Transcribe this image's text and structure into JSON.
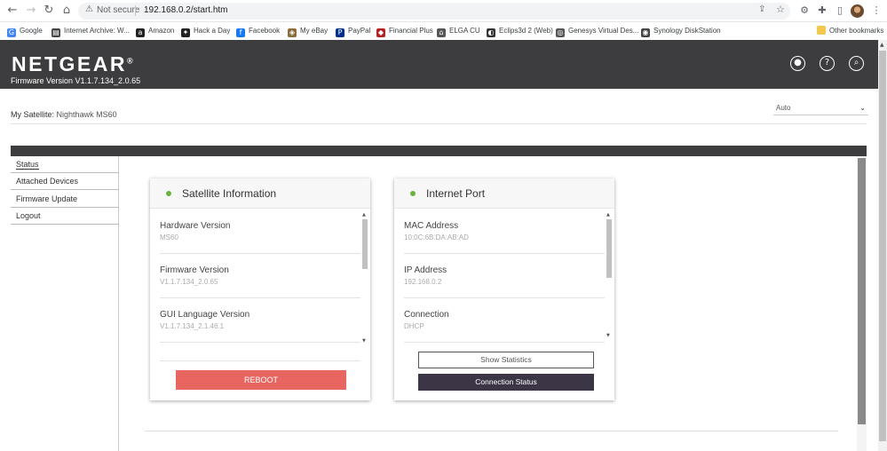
{
  "browser": {
    "not_secure": "Not secure",
    "url": "192.168.0.2/start.htm",
    "bookmarks": [
      {
        "label": "Google",
        "icon": "google-icon",
        "color": "#4285f4"
      },
      {
        "label": "Internet Archive: W...",
        "icon": "archive-icon",
        "color": "#444444"
      },
      {
        "label": "Amazon",
        "icon": "amazon-icon",
        "color": "#222222"
      },
      {
        "label": "Hack a Day",
        "icon": "hackaday-icon",
        "color": "#222222"
      },
      {
        "label": "Facebook",
        "icon": "facebook-icon",
        "color": "#1877f2"
      },
      {
        "label": "My eBay",
        "icon": "ebay-icon",
        "color": "#8a6d3b"
      },
      {
        "label": "PayPal",
        "icon": "paypal-icon",
        "color": "#003087"
      },
      {
        "label": "Financial Plus",
        "icon": "financial-plus-icon",
        "color": "#b22222"
      },
      {
        "label": "ELGA CU",
        "icon": "elga-icon",
        "color": "#555555"
      },
      {
        "label": "Eclips3d 2 (Web)",
        "icon": "eclips3d-icon",
        "color": "#333333"
      },
      {
        "label": "Genesys Virtual Des...",
        "icon": "genesys-icon",
        "color": "#555555"
      },
      {
        "label": "Synology DiskStation",
        "icon": "synology-icon",
        "color": "#444444"
      }
    ],
    "other_bookmarks": "Other bookmarks"
  },
  "header": {
    "logo": "NETGEAR",
    "logo_mark": "®",
    "firmware_label": "Firmware Version V1.1.7.134_2.0.65"
  },
  "satellite": {
    "label": "My Satellite:",
    "value": "Nighthawk MS60",
    "selector_value": "Auto"
  },
  "nav": [
    {
      "label": "Status"
    },
    {
      "label": "Attached Devices"
    },
    {
      "label": "Firmware Update"
    },
    {
      "label": "Logout"
    }
  ],
  "satellite_card": {
    "title": "Satellite Information",
    "fields": [
      {
        "label": "Hardware Version",
        "value": "MS60"
      },
      {
        "label": "Firmware Version",
        "value": "V1.1.7.134_2.0.65"
      },
      {
        "label": "GUI Language Version",
        "value": "V1.1.7.134_2.1.46.1"
      }
    ],
    "reboot": "REBOOT"
  },
  "internet_card": {
    "title": "Internet Port",
    "fields": [
      {
        "label": "MAC Address",
        "value": "10:0C:6B:DA:AB:AD"
      },
      {
        "label": "IP Address",
        "value": "192.168.0.2"
      },
      {
        "label": "Connection",
        "value": "DHCP"
      }
    ],
    "show_statistics": "Show Statistics",
    "connection_status": "Connection Status"
  },
  "colors": {
    "header_bg": "#3d3c3e",
    "status_dot": "#69b53b",
    "reboot_bg": "#e8665f",
    "dark_button": "#3b3545"
  }
}
